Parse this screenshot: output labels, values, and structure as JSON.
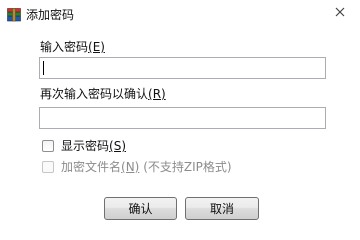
{
  "window": {
    "title": "添加密码",
    "close_glyph": "✕",
    "icon": "winrar-icon"
  },
  "password": {
    "label": "输入密码",
    "accelerator": "(E)",
    "value": ""
  },
  "confirm_password": {
    "label": "再次输入密码以确认",
    "accelerator": "(R)",
    "value": ""
  },
  "show_password": {
    "label": "显示密码",
    "accelerator": "(S)",
    "checked": false
  },
  "encrypt_names": {
    "label": "加密文件名",
    "accelerator": "(N)",
    "note": "(不支持ZIP格式)",
    "checked": false,
    "enabled": false
  },
  "buttons": {
    "ok_label": "确认",
    "cancel_label": "取消"
  }
}
